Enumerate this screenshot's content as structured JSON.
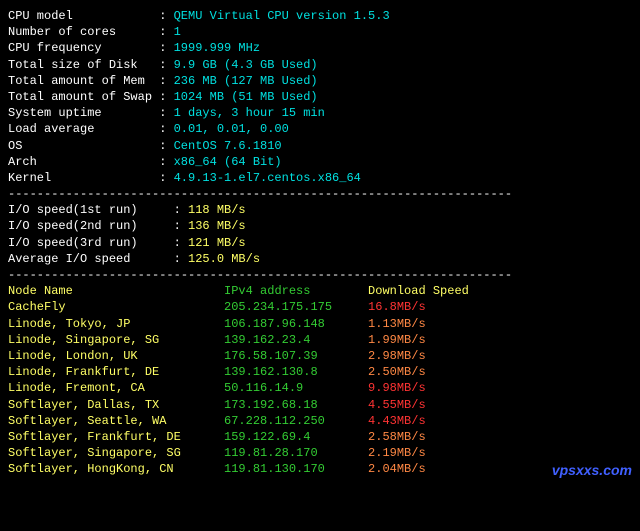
{
  "sys": {
    "cpu_model": {
      "label": "CPU model",
      "value": "QEMU Virtual CPU version 1.5.3"
    },
    "cores": {
      "label": "Number of cores",
      "value": "1"
    },
    "freq": {
      "label": "CPU frequency",
      "value": "1999.999 MHz"
    },
    "disk": {
      "label": "Total size of Disk",
      "value": "9.9 GB (4.3 GB Used)"
    },
    "mem": {
      "label": "Total amount of Mem",
      "value": "236 MB (127 MB Used)"
    },
    "swap": {
      "label": "Total amount of Swap",
      "value": "1024 MB (51 MB Used)"
    },
    "uptime": {
      "label": "System uptime",
      "value": "1 days, 3 hour 15 min"
    },
    "load": {
      "label": "Load average",
      "value": "0.01, 0.01, 0.00"
    },
    "os": {
      "label": "OS",
      "value": "CentOS 7.6.1810"
    },
    "arch": {
      "label": "Arch",
      "value": "x86_64 (64 Bit)"
    },
    "kernel": {
      "label": "Kernel",
      "value": "4.9.13-1.el7.centos.x86_64"
    }
  },
  "dash": "----------------------------------------------------------------------",
  "io": {
    "r1": {
      "label": "I/O speed(1st run)",
      "value": "118 MB/s"
    },
    "r2": {
      "label": "I/O speed(2nd run)",
      "value": "136 MB/s"
    },
    "r3": {
      "label": "I/O speed(3rd run)",
      "value": "121 MB/s"
    },
    "avg": {
      "label": "Average I/O speed",
      "value": "125.0 MB/s"
    }
  },
  "net_hdr": {
    "node": "Node Name",
    "ip": "IPv4 address",
    "speed": "Download Speed"
  },
  "nodes": {
    "n0": {
      "name": "CacheFly",
      "ip": "205.234.175.175",
      "speed": "16.8MB/s"
    },
    "n1": {
      "name": "Linode, Tokyo, JP",
      "ip": "106.187.96.148",
      "speed": "1.13MB/s"
    },
    "n2": {
      "name": "Linode, Singapore, SG",
      "ip": "139.162.23.4",
      "speed": "1.99MB/s"
    },
    "n3": {
      "name": "Linode, London, UK",
      "ip": "176.58.107.39",
      "speed": "2.98MB/s"
    },
    "n4": {
      "name": "Linode, Frankfurt, DE",
      "ip": "139.162.130.8",
      "speed": "2.50MB/s"
    },
    "n5": {
      "name": "Linode, Fremont, CA",
      "ip": "50.116.14.9",
      "speed": "9.98MB/s"
    },
    "n6": {
      "name": "Softlayer, Dallas, TX",
      "ip": "173.192.68.18",
      "speed": "4.55MB/s"
    },
    "n7": {
      "name": "Softlayer, Seattle, WA",
      "ip": "67.228.112.250",
      "speed": "4.43MB/s"
    },
    "n8": {
      "name": "Softlayer, Frankfurt, DE",
      "ip": "159.122.69.4",
      "speed": "2.58MB/s"
    },
    "n9": {
      "name": "Softlayer, Singapore, SG",
      "ip": "119.81.28.170",
      "speed": "2.19MB/s"
    },
    "n10": {
      "name": "Softlayer, HongKong, CN",
      "ip": "119.81.130.170",
      "speed": "2.04MB/s"
    }
  },
  "watermark": "vpsxxs.com"
}
